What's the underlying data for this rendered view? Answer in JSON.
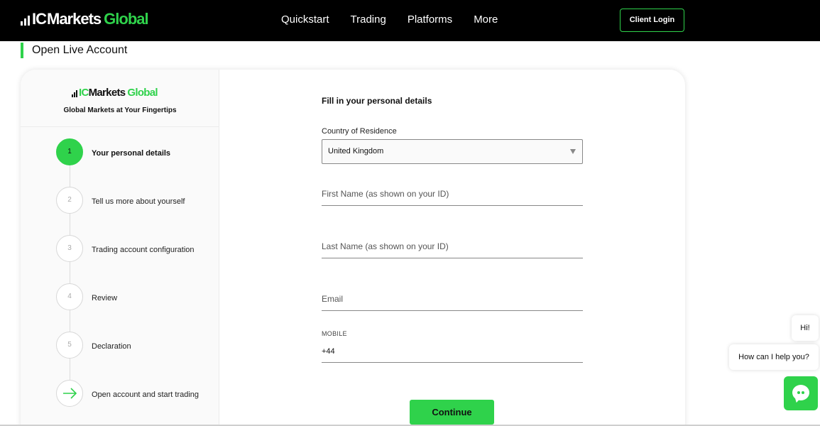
{
  "header": {
    "logo": {
      "ic": "IC",
      "markets": "Markets",
      "global": "Global"
    },
    "nav": [
      "Quickstart",
      "Trading",
      "Platforms",
      "More"
    ],
    "login_label": "Client Login"
  },
  "page": {
    "title": "Open Live Account"
  },
  "sidebar": {
    "logo": {
      "ic": "IC",
      "markets": "Markets",
      "global": "Global"
    },
    "tagline": "Global Markets at Your Fingertips",
    "steps": [
      {
        "number": "1",
        "label": "Your personal details",
        "active": true
      },
      {
        "number": "2",
        "label": "Tell us more about yourself",
        "active": false
      },
      {
        "number": "3",
        "label": "Trading account configuration",
        "active": false
      },
      {
        "number": "4",
        "label": "Review",
        "active": false
      },
      {
        "number": "5",
        "label": "Declaration",
        "active": false
      },
      {
        "icon": "arrow-right-icon",
        "label": "Open account and start trading",
        "active": false
      }
    ]
  },
  "form": {
    "heading": "Fill in your personal details",
    "country_label": "Country of Residence",
    "country_value": "United Kingdom",
    "first_name_placeholder": "First Name (as shown on your ID)",
    "last_name_placeholder": "Last Name (as shown on your ID)",
    "email_placeholder": "Email",
    "mobile_label": "MOBILE",
    "mobile_value": "+44",
    "continue_label": "Continue"
  },
  "chat": {
    "greeting": "Hi!",
    "prompt": "How can I help you?",
    "icon": "chat-icon"
  },
  "colors": {
    "accent": "#2fd24b",
    "header_bg": "#000000"
  }
}
